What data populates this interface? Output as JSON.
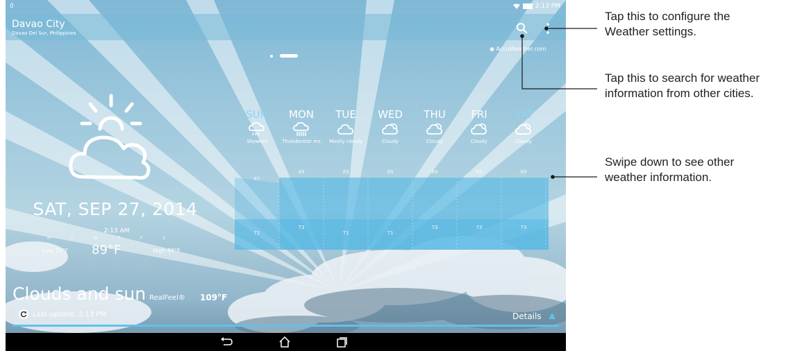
{
  "status_bar": {
    "left_indicator": "0",
    "time": "2:13 PM"
  },
  "location": {
    "city": "Davao City",
    "region": "Davao Del Sur, Philippines"
  },
  "header": {
    "search_icon": "search-icon",
    "menu_icon": "more-vert-icon"
  },
  "provider": "AccuWeather.com",
  "pager": {
    "pages": 2,
    "active": 2
  },
  "current": {
    "icon": "partly-cloudy-icon",
    "date": "SAT, SEP 27, 2014",
    "time": "2:13 AM",
    "week_letters": [
      "M",
      "T",
      "W",
      "T",
      "F",
      "S"
    ],
    "low": "Low 71°F",
    "temp": "89°F",
    "high": "High 89°F",
    "condition": "Clouds and sun",
    "realfeel_label": "RealFeel®",
    "realfeel_value": "109°F",
    "last_update": "Last update: 2:13 PM",
    "details_label": "Details"
  },
  "forecast": [
    {
      "day": "SUN",
      "condition": "Showers",
      "icon": "showers-icon",
      "high": "87",
      "low": "71",
      "weekend": true
    },
    {
      "day": "MON",
      "condition": "Thunderstorms",
      "condition_display": "Thunderstor ms",
      "icon": "thunderstorm-icon",
      "high": "89",
      "low": "73",
      "weekend": false
    },
    {
      "day": "TUE",
      "condition": "Mostly cloudy",
      "icon": "cloud-icon",
      "high": "89",
      "low": "71",
      "weekend": false
    },
    {
      "day": "WED",
      "condition": "Cloudy",
      "icon": "cloudy-icon",
      "high": "89",
      "low": "71",
      "weekend": false
    },
    {
      "day": "THU",
      "condition": "Cloudy",
      "icon": "cloudy-icon",
      "high": "89",
      "low": "73",
      "weekend": false
    },
    {
      "day": "FRI",
      "condition": "Cloudy",
      "icon": "cloudy-icon",
      "high": "89",
      "low": "73",
      "weekend": false
    },
    {
      "day": "SAT",
      "condition": "Cloudy",
      "icon": "cloudy-icon",
      "high": "89",
      "low": "73",
      "weekend": true
    }
  ],
  "nav": {
    "back": "back-icon",
    "home": "home-icon",
    "recents": "recents-icon"
  },
  "annotations": [
    "Tap this to configure the Weather settings.",
    "Tap this to search for weather information from other cities.",
    "Swipe down to see other weather information."
  ],
  "annotation_lines": {
    "settings": [
      "Tap this to configure the",
      "Weather settings."
    ],
    "search": [
      "Tap this to search for weather",
      "information from other cities."
    ],
    "swipe": [
      "Swipe down to see other",
      "weather information."
    ]
  },
  "colors": {
    "accent": "#5fc1ee",
    "weekend_day": "#8fd3f4",
    "temp_band": "#58b8e4",
    "callout_line": "#1a1a1a"
  }
}
